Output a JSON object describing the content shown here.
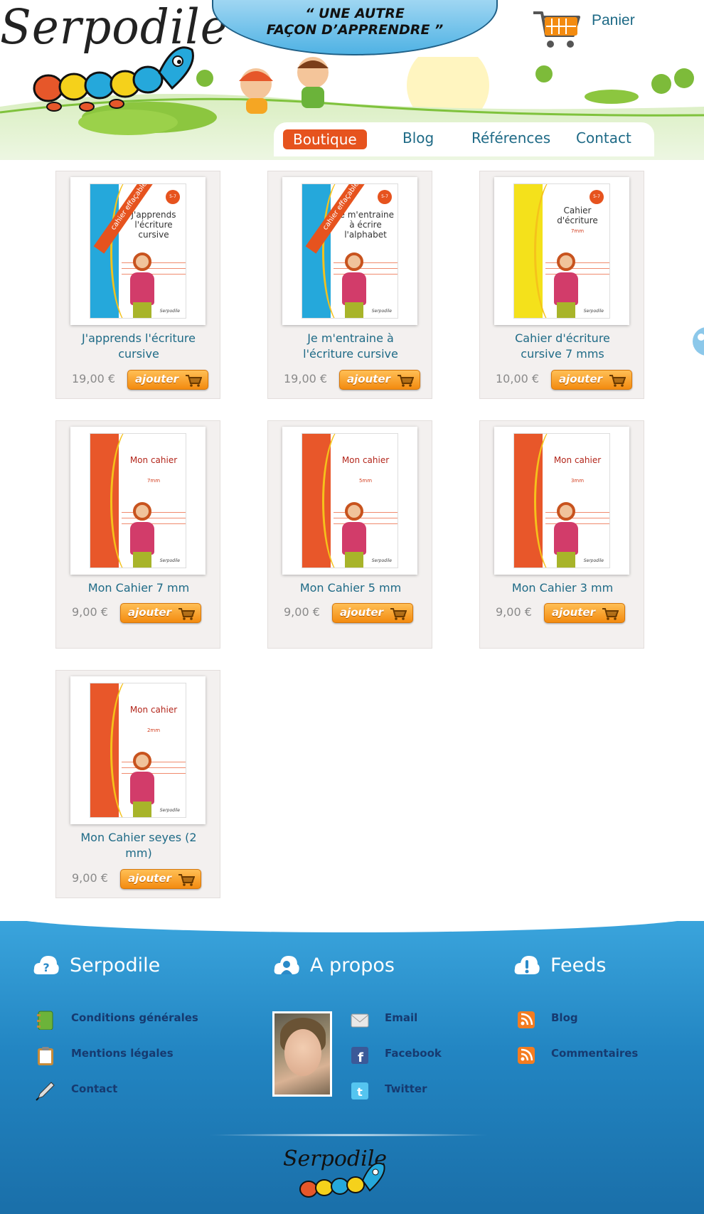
{
  "header": {
    "logo_text": "Serpodile",
    "tagline_line1": "“ Une autre",
    "tagline_line2": "façon d’apprendre ”",
    "cart_label": "Panier"
  },
  "nav": {
    "items": [
      {
        "label": "Boutique",
        "active": true
      },
      {
        "label": "Blog",
        "active": false
      },
      {
        "label": "Références",
        "active": false
      },
      {
        "label": "Contact",
        "active": false
      }
    ]
  },
  "products": [
    {
      "name_line1": "J'apprends l'écriture",
      "name_line2": "cursive",
      "price": "19,00 €",
      "button": "ajouter",
      "cover": {
        "title": "J'apprends l'écriture cursive",
        "sash": "cahier effaçable",
        "age": "5-7 ans",
        "band_color": "#25a8db"
      }
    },
    {
      "name_line1": "Je m'entraine à",
      "name_line2": "l'écriture cursive",
      "price": "19,00 €",
      "button": "ajouter",
      "cover": {
        "title": "Je m'entraîne à écrire l'alphabet",
        "sash": "cahier effaçable",
        "age": "5-7 ans",
        "band_color": "#25a8db"
      }
    },
    {
      "name_line1": "Cahier d'écriture",
      "name_line2": "cursive 7 mms",
      "price": "10,00 €",
      "button": "ajouter",
      "cover": {
        "title": "Cahier d'écriture",
        "sub": "7mm",
        "age": "5-7 ans",
        "band_color": "#f4e11b"
      }
    },
    {
      "name_line1": "Mon Cahier 7 mm",
      "name_line2": "",
      "price": "9,00 €",
      "button": "ajouter",
      "cover": {
        "title": "Mon cahier",
        "sub": "7mm",
        "band_color": "#e8572a"
      }
    },
    {
      "name_line1": "Mon Cahier 5 mm",
      "name_line2": "",
      "price": "9,00 €",
      "button": "ajouter",
      "cover": {
        "title": "Mon cahier",
        "sub": "5mm",
        "band_color": "#e8572a"
      }
    },
    {
      "name_line1": "Mon Cahier 3 mm",
      "name_line2": "",
      "price": "9,00 €",
      "button": "ajouter",
      "cover": {
        "title": "Mon cahier",
        "sub": "3mm",
        "band_color": "#e8572a"
      }
    },
    {
      "name_line1": "Mon Cahier seyes (2",
      "name_line2": "mm)",
      "price": "9,00 €",
      "button": "ajouter",
      "cover": {
        "title": "Mon cahier",
        "sub": "2mm",
        "band_color": "#e8572a"
      }
    }
  ],
  "footer": {
    "col1": {
      "title": "Serpodile",
      "links": [
        "Conditions générales",
        "Mentions légales",
        "Contact"
      ]
    },
    "col2": {
      "title": "A propos",
      "links": [
        "Email",
        "Facebook",
        "Twitter"
      ]
    },
    "col3": {
      "title": "Feeds",
      "links": [
        "Blog",
        "Commentaires"
      ]
    },
    "logo_text": "Serpodile"
  },
  "colors": {
    "accent_orange": "#e6531e",
    "link_teal": "#1e6a86",
    "footer_blue": "#2285c2",
    "button_orange": "#f38b10"
  }
}
